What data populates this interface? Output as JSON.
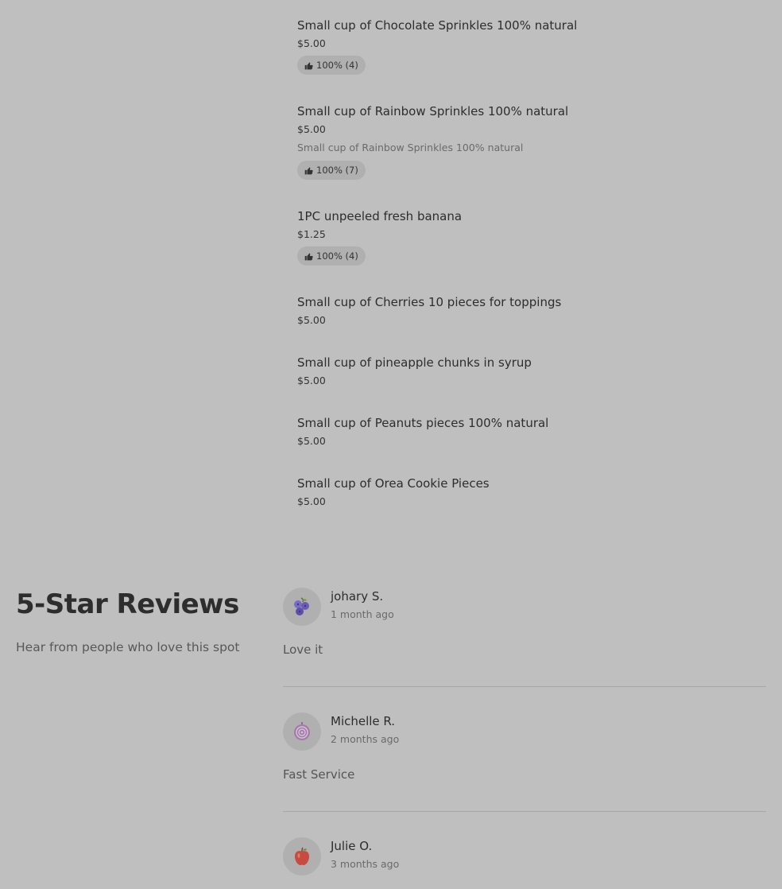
{
  "menu_items": [
    {
      "name": "Small cup of Chocolate Sprinkles 100% natural",
      "price": "$5.00",
      "rating": "100% (4)"
    },
    {
      "name": "Small cup of Rainbow Sprinkles 100% natural",
      "price": "$5.00",
      "description": "Small cup of Rainbow Sprinkles 100% natural",
      "rating": "100% (7)"
    },
    {
      "name": "1PC unpeeled fresh banana",
      "price": "$1.25",
      "rating": "100% (4)"
    },
    {
      "name": "Small cup of Cherries 10 pieces for toppings",
      "price": "$5.00"
    },
    {
      "name": "Small cup of pineapple chunks in syrup",
      "price": "$5.00"
    },
    {
      "name": "Small cup of Peanuts pieces 100% natural",
      "price": "$5.00"
    },
    {
      "name": "Small cup of Orea Cookie Pieces",
      "price": "$5.00"
    }
  ],
  "reviews_section": {
    "title": "5-Star Reviews",
    "subtitle": "Hear from people who love this spot"
  },
  "reviews": [
    {
      "name": "johary S.",
      "time": "1 month ago",
      "text": "Love it",
      "avatar_icon": "blueberry-icon"
    },
    {
      "name": "Michelle R.",
      "time": "2 months ago",
      "text": "Fast Service",
      "avatar_icon": "onion-icon"
    },
    {
      "name": "Julie O.",
      "time": "3 months ago",
      "text": "",
      "avatar_icon": "apple-icon"
    }
  ],
  "icons": {
    "rating": "thumbs-up-icon"
  },
  "colors": {
    "background": "#bfbfbf",
    "badge": "#b0b0b0",
    "divider": "#a8a8a8"
  }
}
